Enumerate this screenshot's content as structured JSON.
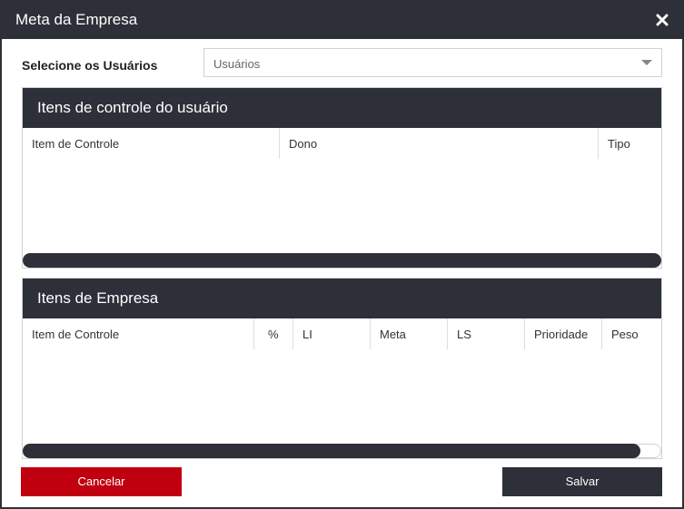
{
  "dialog": {
    "title": "Meta da Empresa",
    "close_icon": "close-icon"
  },
  "user_select": {
    "label": "Selecione os Usuários",
    "value": "Usuários",
    "caret_icon": "chevron-down-icon"
  },
  "user_items": {
    "title": "Itens de controle do usuário",
    "columns": [
      "Item de Controle",
      "Dono",
      "Tipo"
    ]
  },
  "company_items": {
    "title": "Itens de Empresa",
    "columns": [
      "Item de Controle",
      "%",
      "LI",
      "Meta",
      "LS",
      "Prioridade",
      "Peso"
    ]
  },
  "actions": {
    "cancel_label": "Cancelar",
    "save_label": "Salvar"
  },
  "colors": {
    "header_dark": "#2d3038",
    "cancel_red": "#c0000e"
  }
}
